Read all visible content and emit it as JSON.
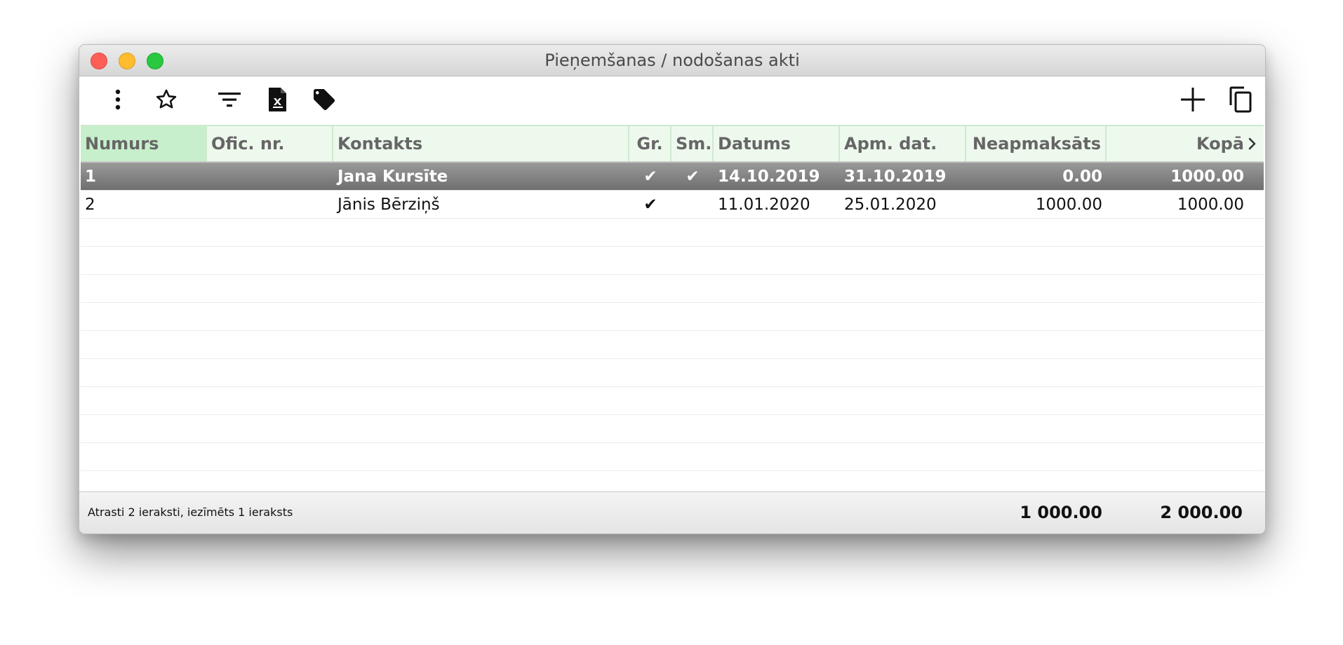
{
  "window": {
    "title": "Pieņemšanas / nodošanas akti"
  },
  "toolbar": {
    "left_icons": [
      "more-vertical-icon",
      "star-icon",
      "filter-icon",
      "document-excel-icon",
      "tag-icon"
    ],
    "right_icons": [
      "add-icon",
      "copy-icon"
    ]
  },
  "columns": [
    {
      "key": "numurs",
      "label": "Numurs",
      "sorted": true
    },
    {
      "key": "ofic_nr",
      "label": "Ofic. nr."
    },
    {
      "key": "kontakts",
      "label": "Kontakts"
    },
    {
      "key": "gr",
      "label": "Gr."
    },
    {
      "key": "sm",
      "label": "Sm."
    },
    {
      "key": "datums",
      "label": "Datums"
    },
    {
      "key": "apm_dat",
      "label": "Apm. dat."
    },
    {
      "key": "neapmaksats",
      "label": "Neapmaksāts"
    },
    {
      "key": "kopa",
      "label": "Kopā"
    }
  ],
  "rows": [
    {
      "numurs": "1",
      "ofic_nr": "",
      "kontakts": "Jana Kursīte",
      "gr": "✔",
      "sm": "✔",
      "datums": "14.10.2019",
      "apm_dat": "31.10.2019",
      "neapmaksats": "0.00",
      "kopa": "1000.00",
      "selected": true
    },
    {
      "numurs": "2",
      "ofic_nr": "",
      "kontakts": "Jānis Bērziņš",
      "gr": "✔",
      "sm": "",
      "datums": "11.01.2020",
      "apm_dat": "25.01.2020",
      "neapmaksats": "1000.00",
      "kopa": "1000.00",
      "selected": false
    }
  ],
  "footer": {
    "status": "Atrasti 2 ieraksti, iezīmēts 1 ieraksts",
    "total_neapmaksats": "1 000.00",
    "total_kopa": "2 000.00"
  },
  "colors": {
    "header_bg": "#eef9ee",
    "sorted_header_bg": "#c7efcb",
    "selected_row": "#808080"
  }
}
